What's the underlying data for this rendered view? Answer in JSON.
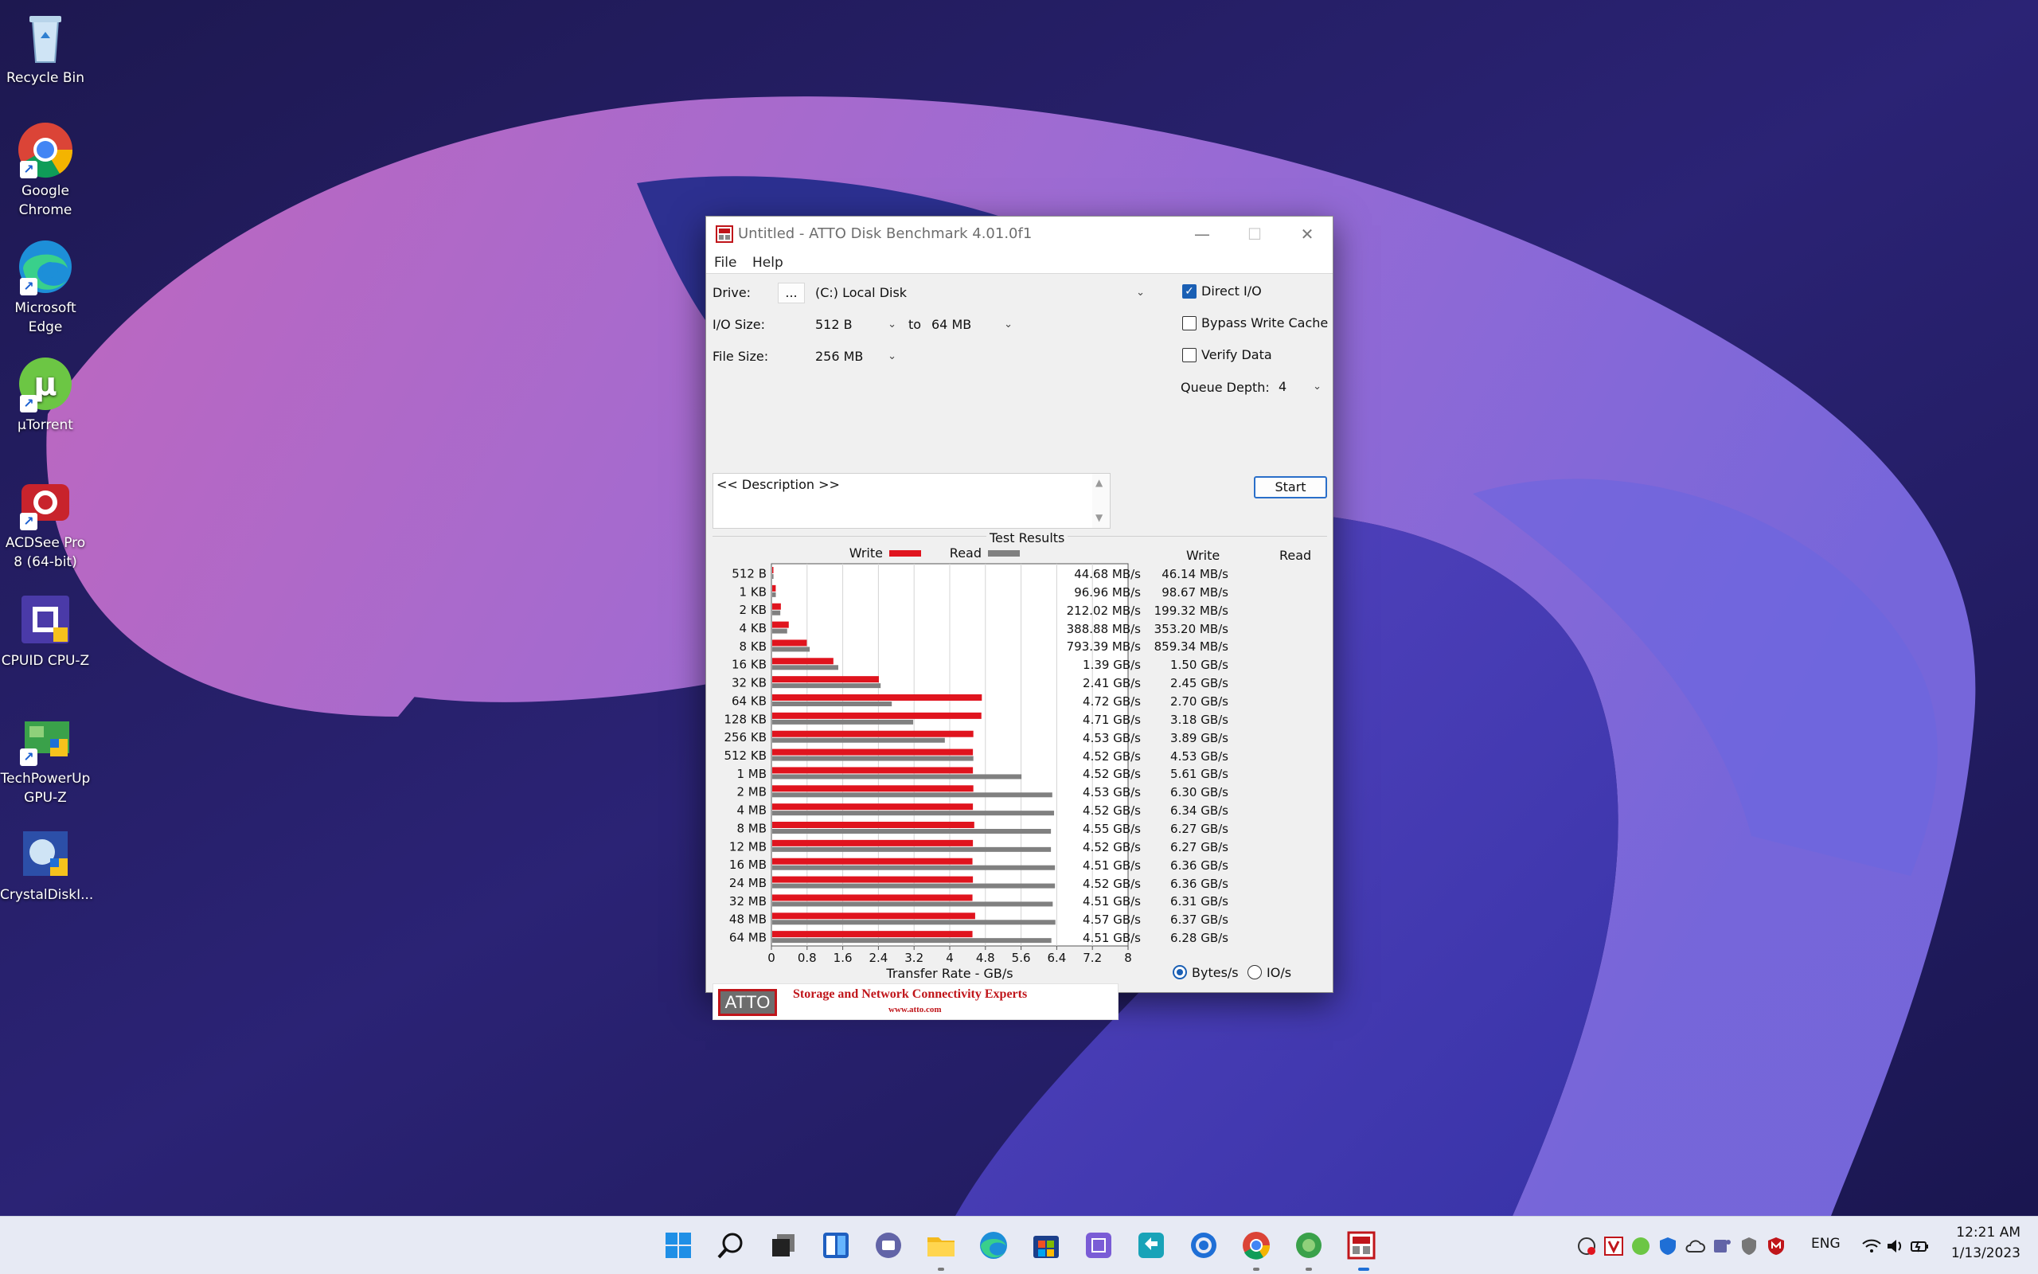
{
  "desktop": {
    "icons": [
      {
        "label": "Recycle Bin"
      },
      {
        "label": "Google Chrome"
      },
      {
        "label": "Microsoft Edge"
      },
      {
        "label": "µTorrent"
      },
      {
        "label": "ACDSee Pro 8 (64-bit)"
      },
      {
        "label": "CPUID CPU-Z"
      },
      {
        "label": "TechPowerUp GPU-Z"
      },
      {
        "label": "CrystalDiskI..."
      }
    ]
  },
  "window": {
    "title": "Untitled - ATTO Disk Benchmark 4.01.0f1",
    "minimize": "—",
    "maximize": "☐",
    "close": "✕"
  },
  "menu": {
    "file": "File",
    "help": "Help"
  },
  "settings": {
    "drive_label": "Drive:",
    "browse_label": "...",
    "drive_value": "(C:) Local Disk",
    "io_size_label": "I/O Size:",
    "io_from": "512 B",
    "to_label": "to",
    "io_to": "64 MB",
    "file_size_label": "File Size:",
    "file_size": "256 MB",
    "direct_io": "Direct I/O",
    "direct_io_checked": true,
    "bypass_write_cache": "Bypass Write Cache",
    "verify_data": "Verify Data",
    "queue_depth_label": "Queue Depth:",
    "queue_depth": "4",
    "start": "Start",
    "description": "<< Description >>"
  },
  "results": {
    "title": "Test Results",
    "legend_write": "Write",
    "legend_read": "Read",
    "col_write": "Write",
    "col_read": "Read",
    "xlabel": "Transfer Rate - GB/s",
    "unit_bytes": "Bytes/s",
    "unit_ios": "IO/s",
    "rows": [
      {
        "size": "512 B",
        "write": "44.68 MB/s",
        "read": "46.14 MB/s"
      },
      {
        "size": "1 KB",
        "write": "96.96 MB/s",
        "read": "98.67 MB/s"
      },
      {
        "size": "2 KB",
        "write": "212.02 MB/s",
        "read": "199.32 MB/s"
      },
      {
        "size": "4 KB",
        "write": "388.88 MB/s",
        "read": "353.20 MB/s"
      },
      {
        "size": "8 KB",
        "write": "793.39 MB/s",
        "read": "859.34 MB/s"
      },
      {
        "size": "16 KB",
        "write": "1.39 GB/s",
        "read": "1.50 GB/s"
      },
      {
        "size": "32 KB",
        "write": "2.41 GB/s",
        "read": "2.45 GB/s"
      },
      {
        "size": "64 KB",
        "write": "4.72 GB/s",
        "read": "2.70 GB/s"
      },
      {
        "size": "128 KB",
        "write": "4.71 GB/s",
        "read": "3.18 GB/s"
      },
      {
        "size": "256 KB",
        "write": "4.53 GB/s",
        "read": "3.89 GB/s"
      },
      {
        "size": "512 KB",
        "write": "4.52 GB/s",
        "read": "4.53 GB/s"
      },
      {
        "size": "1 MB",
        "write": "4.52 GB/s",
        "read": "5.61 GB/s"
      },
      {
        "size": "2 MB",
        "write": "4.53 GB/s",
        "read": "6.30 GB/s"
      },
      {
        "size": "4 MB",
        "write": "4.52 GB/s",
        "read": "6.34 GB/s"
      },
      {
        "size": "8 MB",
        "write": "4.55 GB/s",
        "read": "6.27 GB/s"
      },
      {
        "size": "12 MB",
        "write": "4.52 GB/s",
        "read": "6.27 GB/s"
      },
      {
        "size": "16 MB",
        "write": "4.51 GB/s",
        "read": "6.36 GB/s"
      },
      {
        "size": "24 MB",
        "write": "4.52 GB/s",
        "read": "6.36 GB/s"
      },
      {
        "size": "32 MB",
        "write": "4.51 GB/s",
        "read": "6.31 GB/s"
      },
      {
        "size": "48 MB",
        "write": "4.57 GB/s",
        "read": "6.37 GB/s"
      },
      {
        "size": "64 MB",
        "write": "4.51 GB/s",
        "read": "6.28 GB/s"
      }
    ]
  },
  "chart_data": {
    "type": "bar",
    "categories": [
      "512 B",
      "1 KB",
      "2 KB",
      "4 KB",
      "8 KB",
      "16 KB",
      "32 KB",
      "64 KB",
      "128 KB",
      "256 KB",
      "512 KB",
      "1 MB",
      "2 MB",
      "4 MB",
      "8 MB",
      "12 MB",
      "16 MB",
      "24 MB",
      "32 MB",
      "48 MB",
      "64 MB"
    ],
    "series": [
      {
        "name": "Write",
        "values": [
          0.04468,
          0.09696,
          0.21202,
          0.38888,
          0.79339,
          1.39,
          2.41,
          4.72,
          4.71,
          4.53,
          4.52,
          4.52,
          4.53,
          4.52,
          4.55,
          4.52,
          4.51,
          4.52,
          4.51,
          4.57,
          4.51
        ]
      },
      {
        "name": "Read",
        "values": [
          0.04614,
          0.09867,
          0.19932,
          0.3532,
          0.85934,
          1.5,
          2.45,
          2.7,
          3.18,
          3.89,
          4.53,
          5.61,
          6.3,
          6.34,
          6.27,
          6.27,
          6.36,
          6.36,
          6.31,
          6.37,
          6.28
        ]
      }
    ],
    "xlim": [
      0,
      8
    ],
    "xticks": [
      "0",
      "0.8",
      "1.6",
      "2.4",
      "3.2",
      "4",
      "4.8",
      "5.6",
      "6.4",
      "7.2",
      "8"
    ],
    "xlabel": "Transfer Rate - GB/s",
    "grid": true,
    "orientation": "horizontal",
    "colors": {
      "Write": "#e0141e",
      "Read": "#808080"
    }
  },
  "banner": {
    "logo": "ATTO",
    "tagline": "Storage and Network Connectivity Experts",
    "url": "www.atto.com"
  },
  "taskbar": {
    "apps": [
      "start-icon",
      "search-icon",
      "task-view-icon",
      "widgets-icon",
      "teams-chat-icon",
      "file-explorer-icon",
      "edge-icon",
      "store-icon",
      "app-icon",
      "sync-icon",
      "cortana-icon",
      "chrome-icon",
      "gpu-z-icon",
      "atto-icon"
    ],
    "language": "ENG",
    "time": "12:21 AM",
    "date": "1/13/2023"
  },
  "colors": {
    "write": "#e0141e",
    "read": "#808080",
    "accent": "#1a5fb4"
  }
}
